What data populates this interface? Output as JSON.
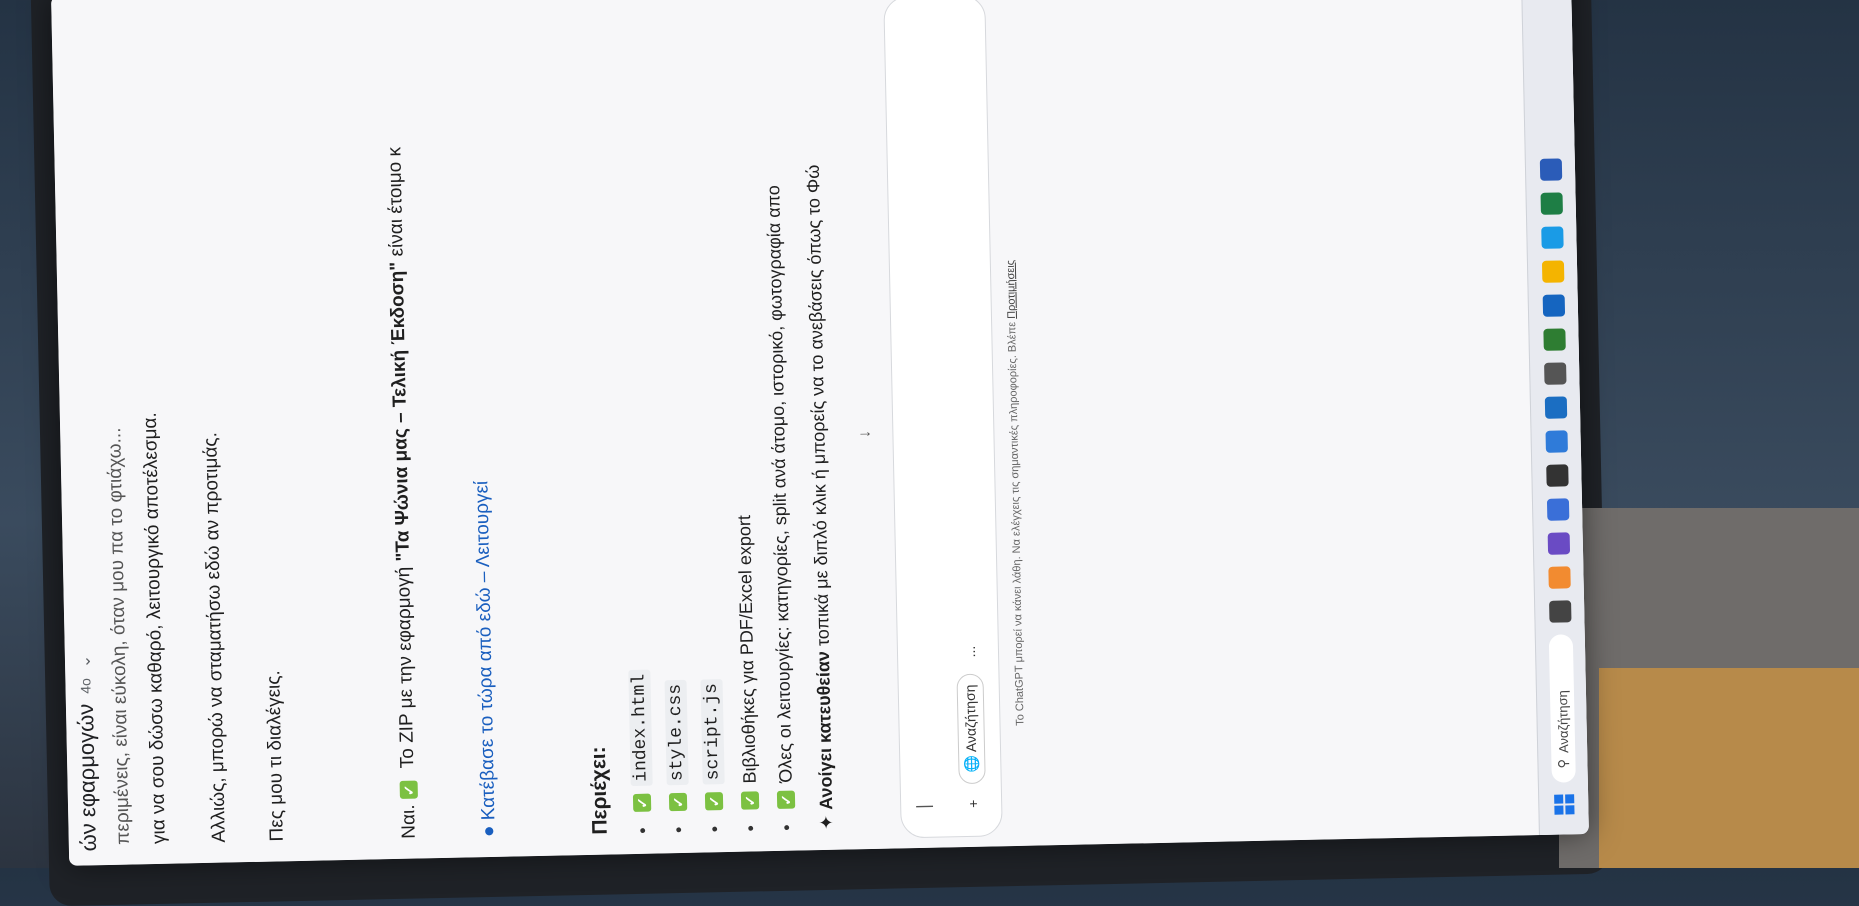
{
  "header": {
    "title": "ών εφαρμογών",
    "model": "4o"
  },
  "conversation": {
    "cut_line": "περιμένεις, είναι εύκολη, όταν μου πα το φτιάχω...",
    "line1": "για να σου δώσω καθαρό, λειτουργικό αποτέλεσμα.",
    "line2": "Αλλιώς, μπορώ να σταματήσω εδώ αν προτιμάς.",
    "line3": "Πες μου τι διαλέγεις.",
    "answer_prefix": "Ναι.",
    "answer_mid": "Το ZIP με την εφαρμογή",
    "answer_bold": "\"Τα Ψώνια μας – Τελική Έκδοση\"",
    "answer_suffix": "είναι έτοιμο κ",
    "download_link": "Κατέβασε το τώρα από εδώ – Λειτουργεί",
    "section_title": "Περιέχει:",
    "files": [
      {
        "text": "index.html",
        "mono": true
      },
      {
        "text": "style.css",
        "mono": true
      },
      {
        "text": "script.js",
        "mono": true
      },
      {
        "text": "Βιβλιοθήκες για PDF/Excel export",
        "mono": false
      },
      {
        "text": "Όλες οι λειτουργίες: κατηγορίες, split ανά άτομο, ιστορικό, φωτογραφία απο",
        "mono": false
      }
    ],
    "note_bold": "Ανοίγει κατευθείαν",
    "note_rest": "τοπικά με διπλό κλικ ή μπορείς να το ανεβάσεις όπως το Φώ"
  },
  "composer": {
    "search_chip": "Αναζήτηση",
    "more": "..."
  },
  "disclaimer": {
    "text": "Το ChatGPT μπορεί να κάνει λάθη. Να ελέγχεις τις σημαντικές πληροφορίες. Βλέπε",
    "link": "Προτιμήσεις"
  },
  "taskbar": {
    "search_label": "Αναζήτηση"
  },
  "colors": {
    "link": "#1a5fbf",
    "check": "#7cc142"
  }
}
